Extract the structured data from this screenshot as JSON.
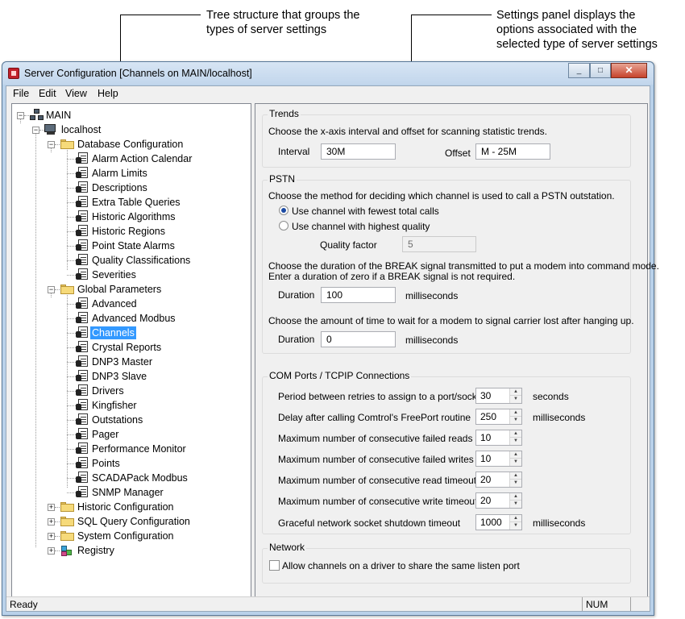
{
  "callouts": {
    "tree": [
      "Tree structure  that groups the",
      "types of server settings"
    ],
    "settings": [
      "Settings panel displays the",
      "options associated with the",
      "selected type of server settings"
    ]
  },
  "window": {
    "title": "Server Configuration [Channels on MAIN/localhost]",
    "minimize_glyph": "_",
    "maximize_glyph": "□",
    "close_glyph": "✕"
  },
  "menu": [
    "File",
    "Edit",
    "View",
    "Help"
  ],
  "tree": {
    "expander_expanded": "−",
    "expander_collapsed": "+",
    "root": "MAIN",
    "server": "localhost",
    "database_configuration": {
      "label": "Database Configuration",
      "items": [
        "Alarm Action Calendar",
        "Alarm Limits",
        "Descriptions",
        "Extra Table Queries",
        "Historic Algorithms",
        "Historic Regions",
        "Point State Alarms",
        "Quality Classifications",
        "Severities"
      ]
    },
    "global_parameters": {
      "label": "Global Parameters",
      "items": [
        "Advanced",
        "Advanced Modbus",
        "Channels",
        "Crystal Reports",
        "DNP3 Master",
        "DNP3 Slave",
        "Drivers",
        "Kingfisher",
        "Outstations",
        "Pager",
        "Performance Monitor",
        "Points",
        "SCADAPack Modbus",
        "SNMP Manager"
      ],
      "selected": "Channels"
    },
    "collapsed": [
      "Historic Configuration",
      "SQL Query Configuration",
      "System Configuration"
    ],
    "registry": "Registry"
  },
  "trends": {
    "title": "Trends",
    "description": "Choose the x-axis interval and offset for scanning statistic trends.",
    "interval_label": "Interval",
    "interval_value": "30M",
    "offset_label": "Offset",
    "offset_value": "M - 25M"
  },
  "pstn": {
    "title": "PSTN",
    "method_description": "Choose the method for deciding which channel is used to call a PSTN outstation.",
    "option_fewest": "Use channel with fewest total calls",
    "option_quality": "Use channel with highest quality",
    "selected_option": "fewest",
    "quality_factor_label": "Quality factor",
    "quality_factor_value": "5",
    "break_description_1": "Choose the duration of the BREAK signal transmitted to put a modem into command mode.",
    "break_description_2": "Enter a duration of zero if a BREAK signal is not required.",
    "break_duration_label": "Duration",
    "break_duration_value": "100",
    "break_unit": "milliseconds",
    "carrier_description": "Choose the amount of time to wait for a modem to signal carrier lost after hanging up.",
    "carrier_duration_label": "Duration",
    "carrier_duration_value": "0",
    "carrier_unit": "milliseconds"
  },
  "com_ports": {
    "title": "COM Ports / TCPIP Connections",
    "spin_up_glyph": "▲",
    "spin_down_glyph": "▼",
    "rows": [
      {
        "label": "Period between retries to assign to a port/socket",
        "value": "30",
        "unit": "seconds"
      },
      {
        "label": "Delay after calling Comtrol's FreePort routine",
        "value": "250",
        "unit": "milliseconds"
      },
      {
        "label": "Maximum number of consecutive failed reads",
        "value": "10",
        "unit": ""
      },
      {
        "label": "Maximum number of consecutive failed writes",
        "value": "10",
        "unit": ""
      },
      {
        "label": "Maximum number of consecutive read timeouts",
        "value": "20",
        "unit": ""
      },
      {
        "label": "Maximum number of consecutive write timeouts",
        "value": "20",
        "unit": ""
      },
      {
        "label": "Graceful network socket shutdown timeout",
        "value": "1000",
        "unit": "milliseconds"
      }
    ]
  },
  "network": {
    "title": "Network",
    "share_port_label": "Allow channels on a driver to share the same listen port",
    "share_port_checked": false
  },
  "status": {
    "text": "Ready",
    "num": "NUM"
  }
}
